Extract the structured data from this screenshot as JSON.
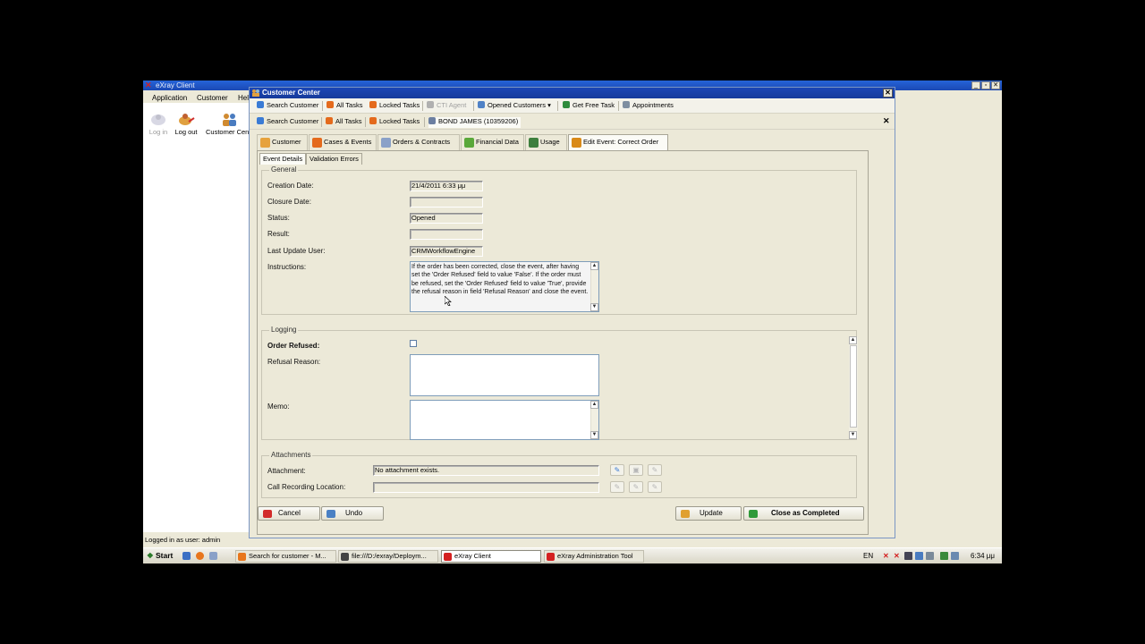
{
  "app": {
    "title": "eXray Client",
    "menu": [
      "Application",
      "Customer",
      "Help"
    ],
    "side_buttons": [
      {
        "label": "Log in",
        "disabled": true
      },
      {
        "label": "Log out",
        "disabled": false
      },
      {
        "label": "Customer Center",
        "disabled": false
      }
    ],
    "window_buttons": [
      "_",
      "▫",
      "✕"
    ]
  },
  "customer_center": {
    "title": "Customer Center",
    "toolbar1": [
      {
        "label": "Search Customer",
        "color": "#3a7bd5"
      },
      {
        "label": "All Tasks",
        "color": "#e46a1c"
      },
      {
        "label": "Locked Tasks",
        "color": "#e46a1c"
      },
      {
        "label": "CTI Agent",
        "color": "#b0b0b0",
        "disabled": true
      },
      {
        "label": "Opened Customers",
        "color": "#5082c6"
      },
      {
        "label": "Get Free Task",
        "color": "#2e8b3c"
      },
      {
        "label": "Appointments",
        "color": "#7e8ea0"
      }
    ],
    "toolbar1_dropdown": "▾",
    "toolbar2": [
      {
        "label": "Search Customer",
        "color": "#3a7bd5"
      },
      {
        "label": "All Tasks",
        "color": "#e46a1c"
      },
      {
        "label": "Locked Tasks",
        "color": "#e46a1c"
      },
      {
        "label": "BOND JAMES (10359206)",
        "color": "#6c7fa1"
      }
    ],
    "tabs": [
      {
        "label": "Customer",
        "color": "#e6a23c"
      },
      {
        "label": "Cases & Events",
        "color": "#e46a1c"
      },
      {
        "label": "Orders & Contracts",
        "color": "#8aa1c8"
      },
      {
        "label": "Financial Data",
        "color": "#5aa83a"
      },
      {
        "label": "Usage",
        "color": "#3d7f3d"
      },
      {
        "label": "Edit Event: Correct Order",
        "color": "#d98a18"
      }
    ],
    "subtabs": [
      "Event Details",
      "Validation Errors"
    ],
    "general": {
      "title": "General",
      "creation_date_label": "Creation Date:",
      "creation_date": "21/4/2011 6:33 μμ",
      "closure_date_label": "Closure Date:",
      "closure_date": "",
      "status_label": "Status:",
      "status": "Opened",
      "result_label": "Result:",
      "result": "",
      "last_update_user_label": "Last Update User:",
      "last_update_user": "CRMWorkflowEngine",
      "instructions_label": "Instructions:",
      "instructions": "If the order has been corrected, close the event, after having set the 'Order Refused' field to value 'False'. If the order must be refused, set the 'Order Refused' field to value 'True', provide the refusal reason in field 'Refusal Reason' and close the event."
    },
    "logging": {
      "title": "Logging",
      "order_refused_label": "Order Refused:",
      "refusal_reason_label": "Refusal Reason:",
      "memo_label": "Memo:"
    },
    "attachments": {
      "title": "Attachments",
      "attachment_label": "Attachment:",
      "attachment_value": "No attachment exists.",
      "call_recording_label": "Call Recording Location:",
      "call_recording_value": ""
    },
    "buttons": {
      "cancel": "Cancel",
      "undo": "Undo",
      "update": "Update",
      "close_completed": "Close as Completed"
    }
  },
  "status_bar": "Logged in as user: admin",
  "taskbar": {
    "start": "Start",
    "tasks": [
      {
        "label": "Search for customer - M...",
        "color": "#e8761c"
      },
      {
        "label": "file:///D:/exray/Deploym...",
        "color": "#444"
      },
      {
        "label": "eXray Client",
        "color": "#d42020",
        "active": true
      },
      {
        "label": "eXray Administration Tool",
        "color": "#d42020"
      }
    ],
    "lang": "EN",
    "clock": "6:34 μμ"
  }
}
